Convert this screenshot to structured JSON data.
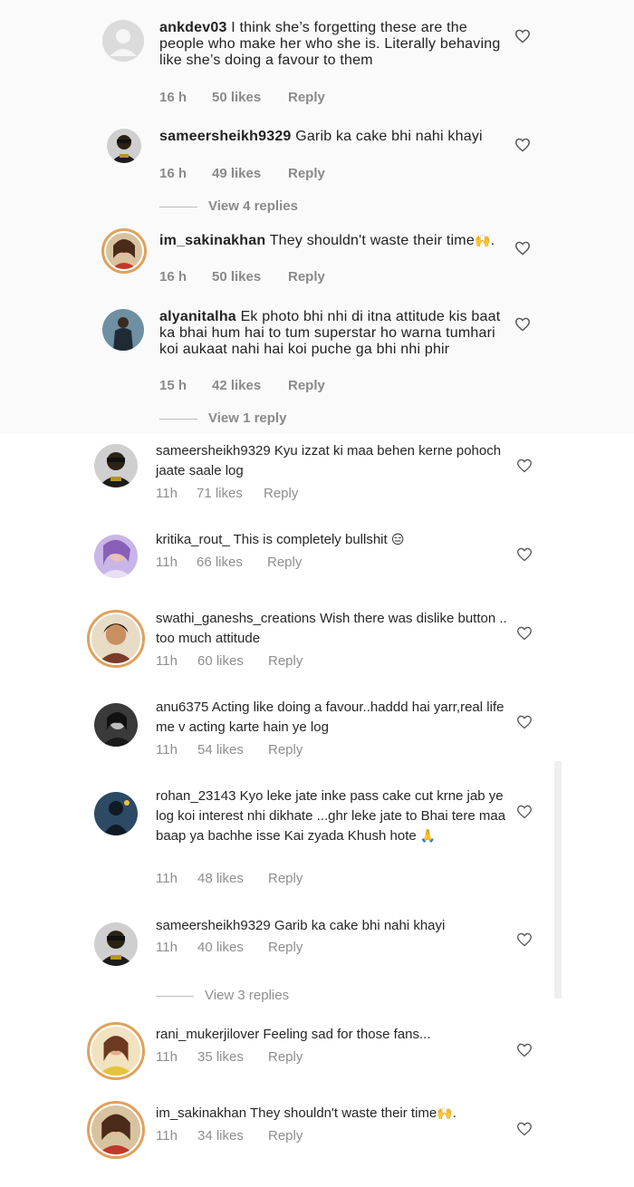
{
  "top_comments": [
    {
      "username": "ankdev03",
      "text": "I think she’s forgetting these are the people who make her who she is. Literally behaving like she’s doing a favour to them",
      "time": "16 h",
      "likes": "50 likes",
      "reply": "Reply"
    },
    {
      "username": "sameersheikh9329",
      "text": "Garib ka cake bhi nahi khayi",
      "time": "16 h",
      "likes": "49 likes",
      "reply": "Reply"
    },
    {
      "username": "im_sakinakhan",
      "text": "They shouldn't waste their time",
      "emoji": "🙌",
      "text_end": ".",
      "time": "16 h",
      "likes": "50 likes",
      "reply": "Reply"
    },
    {
      "username": "alyanitalha",
      "text": "Ek photo bhi nhi di itna attitude kis baat ka bhai hum hai to tum superstar ho warna tumhari koi aukaat nahi hai koi puche ga bhi nhi phir",
      "time": "15 h",
      "likes": "42 likes",
      "reply": "Reply"
    }
  ],
  "top_view_replies": [
    "View 4 replies",
    "View 1 reply"
  ],
  "bottom_comments": [
    {
      "username": "sameersheikh9329",
      "text": "Kyu izzat ki maa behen kerne pohoch jaate saale log",
      "time": "11h",
      "likes": "71 likes",
      "reply": "Reply"
    },
    {
      "username": "kritika_rout_",
      "text": "This is completely bullshit",
      "emoji": "😑",
      "time": "11h",
      "likes": "66 likes",
      "reply": "Reply"
    },
    {
      "username": "swathi_ganeshs_creations",
      "text": "Wish there was dislike button .. too much attitude",
      "time": "11h",
      "likes": "60 likes",
      "reply": "Reply"
    },
    {
      "username": "anu6375",
      "text": "Acting like doing a favour..haddd hai yarr,real life me v acting karte hain ye log",
      "time": "11h",
      "likes": "54 likes",
      "reply": "Reply"
    },
    {
      "username": "rohan_23143",
      "text": "Kyo leke jate inke pass cake cut krne jab ye log koi interest nhi dikhate ...ghr leke jate to Bhai tere  maa baap ya bachhe isse Kai zyada Khush hote",
      "emoji": "🙏",
      "time": "11h",
      "likes": "48 likes",
      "reply": "Reply"
    },
    {
      "username": "sameersheikh9329",
      "text": "Garib ka cake bhi nahi khayi",
      "time": "11h",
      "likes": "40 likes",
      "reply": "Reply"
    },
    {
      "username": "rani_mukerjilover",
      "text": "Feeling sad for those fans...",
      "time": "11h",
      "likes": "35 likes",
      "reply": "Reply"
    },
    {
      "username": "im_sakinakhan",
      "text": "They shouldn't waste their time",
      "emoji": "🙌",
      "text_end": ".",
      "time": "11h",
      "likes": "34 likes",
      "reply": "Reply"
    }
  ],
  "bottom_view_replies": "View 3 replies",
  "icons": {
    "like": "heart-outline-icon"
  },
  "colors": {
    "text": "#262626",
    "meta": "#8e8e8e",
    "ring": "#e0a15c",
    "top_bg": "#fafafa"
  }
}
